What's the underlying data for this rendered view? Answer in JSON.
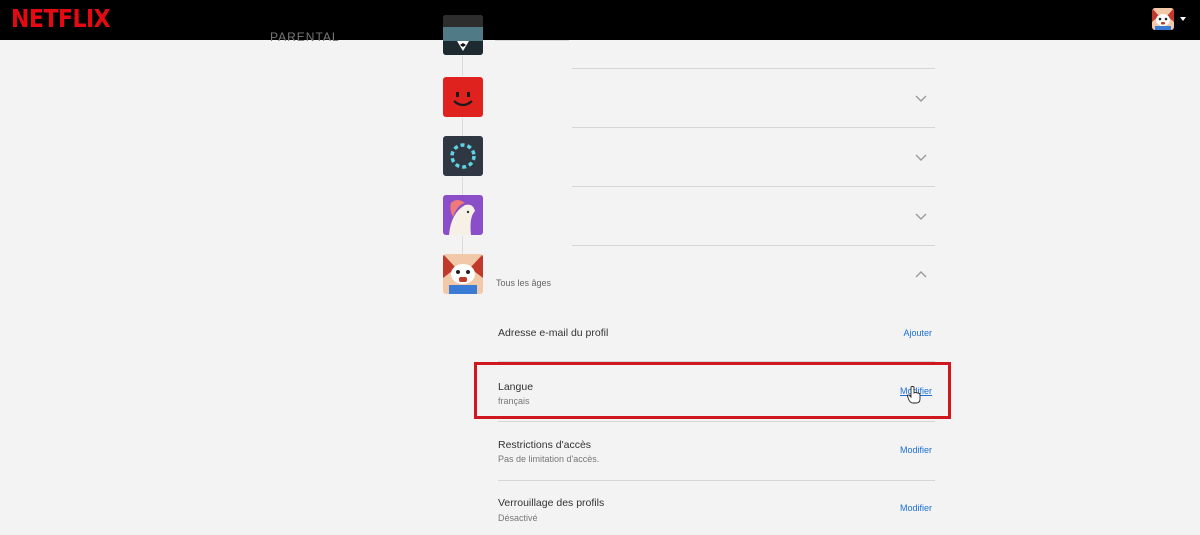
{
  "brand": {
    "logo_text": "NETFLIX",
    "color": "#e50914"
  },
  "header": {
    "account_icon": "aggretsuko-avatar-icon",
    "menu_icon": "caret-down-icon"
  },
  "profiles": [
    {
      "avatar": "tuxedo-avatar-icon",
      "color": "#3b5e6e"
    },
    {
      "avatar": "red-smiley-avatar-icon",
      "color": "#e0221f"
    },
    {
      "avatar": "loading-circle-avatar-icon",
      "color": "#2f3742"
    },
    {
      "avatar": "unicorn-avatar-icon",
      "color": "#8a4ec8"
    },
    {
      "avatar": "aggretsuko-avatar-icon",
      "color": "#d8343b",
      "sub_label": "Tous les âges"
    }
  ],
  "settings": [
    {
      "title": "Adresse e-mail du profil",
      "value": "",
      "action": "Ajouter"
    },
    {
      "title": "Langue",
      "value": "français",
      "action": "Modifier"
    },
    {
      "title": "Restrictions d'accès",
      "value": "Pas de limitation d'accès.",
      "action": "Modifier"
    },
    {
      "title": "Verrouillage des profils",
      "value": "Désactivé",
      "action": "Modifier"
    }
  ],
  "highlight_color": "#d0161f",
  "link_color": "#1a6ed8"
}
